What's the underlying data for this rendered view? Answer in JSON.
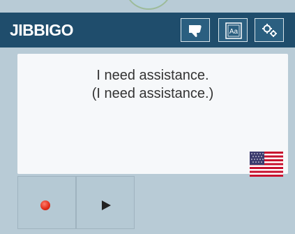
{
  "app": {
    "logo_text": "JIBBIGO"
  },
  "header": {
    "buttons": [
      {
        "icon": "thumbs-down-icon"
      },
      {
        "icon": "text-size-icon",
        "label": "Aa"
      },
      {
        "icon": "gears-icon"
      }
    ]
  },
  "translation": {
    "text": "I need assistance.",
    "back_translation": "(I need assistance.)",
    "language_flag": "us-flag-icon"
  },
  "controls": {
    "record_icon": "record-icon",
    "play_icon": "play-icon"
  },
  "colors": {
    "header_bg": "#1f4d6c",
    "panel_bg": "#b8cbd6",
    "text_box_bg": "#f6f8fa",
    "record_red": "#e02a17"
  }
}
